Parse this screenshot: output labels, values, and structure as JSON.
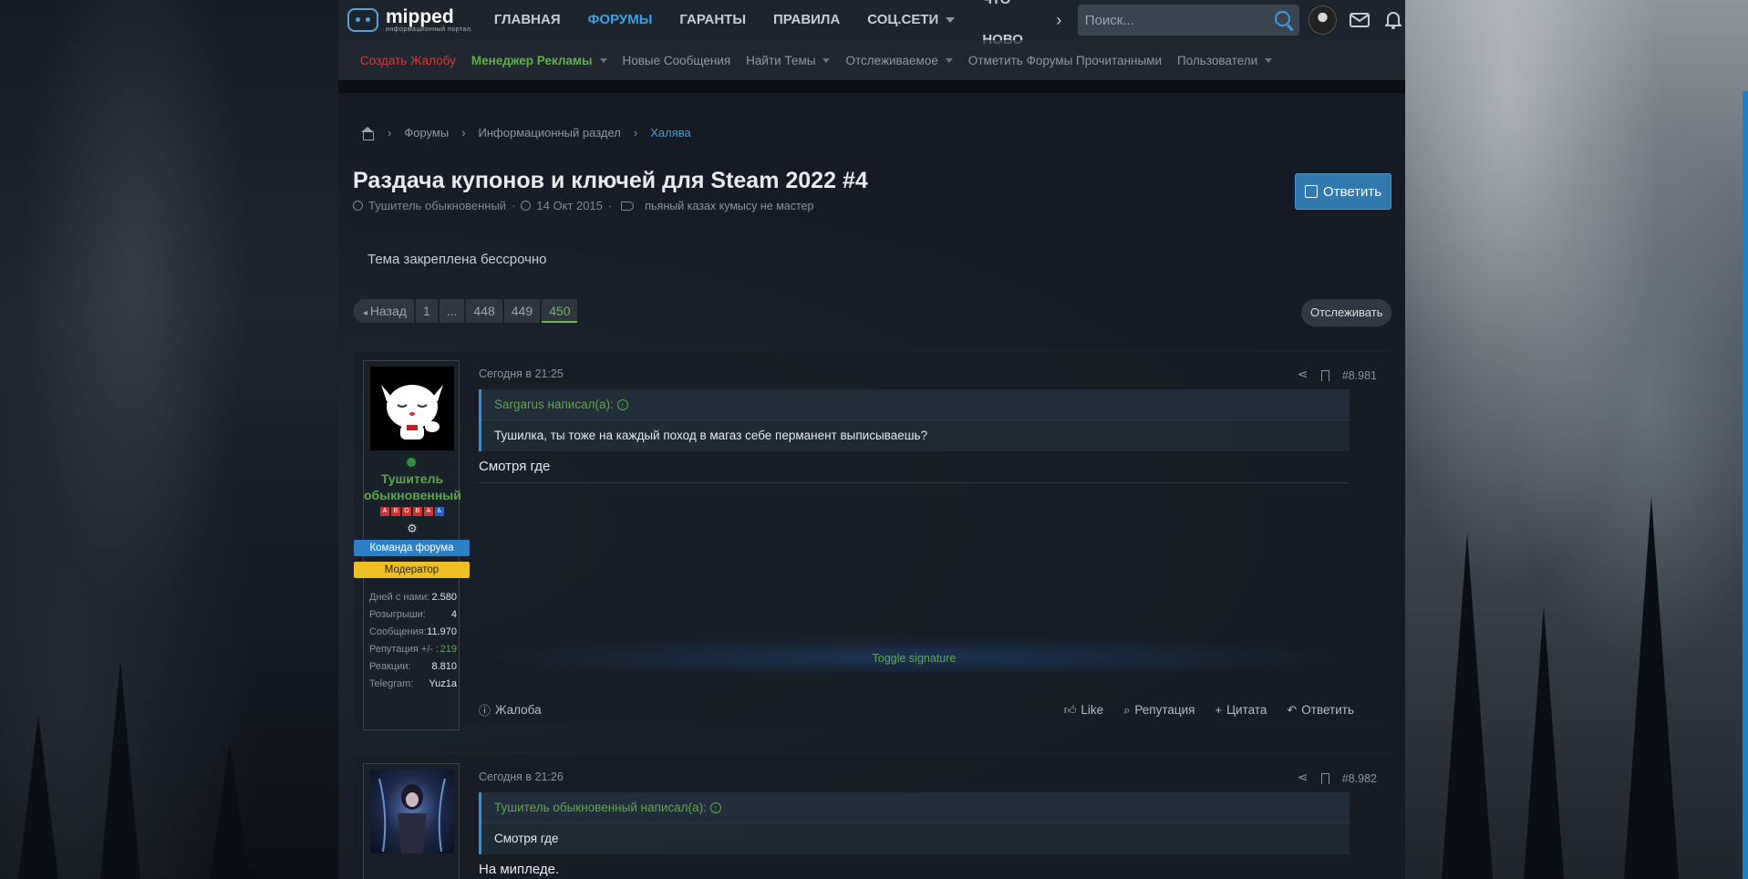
{
  "brand": {
    "name": "mipped",
    "subtitle": "информационный портал"
  },
  "nav": {
    "items": [
      {
        "label": "ГЛАВНАЯ",
        "active": false,
        "caret": false
      },
      {
        "label": "ФОРУМЫ",
        "active": true,
        "caret": false
      },
      {
        "label": "ГАРАНТЫ",
        "active": false,
        "caret": false
      },
      {
        "label": "ПРАВИЛА",
        "active": false,
        "caret": false
      },
      {
        "label": "СОЦ.СЕТИ",
        "active": false,
        "caret": true
      },
      {
        "label": "ЧТО НОВО",
        "active": false,
        "caret": false
      }
    ],
    "more_icon": "chevron-right-icon",
    "search_placeholder": "Поиск..."
  },
  "subnav": {
    "items": [
      {
        "label": "Создать Жалобу",
        "style": "red",
        "caret": false
      },
      {
        "label": "Менеджер Рекламы",
        "style": "green",
        "caret": true
      },
      {
        "label": "Новые Сообщения",
        "style": "",
        "caret": false
      },
      {
        "label": "Найти Темы",
        "style": "",
        "caret": true
      },
      {
        "label": "Отслеживаемое",
        "style": "",
        "caret": true
      },
      {
        "label": "Отметить Форумы Прочитанными",
        "style": "",
        "caret": false
      },
      {
        "label": "Пользователи",
        "style": "",
        "caret": true
      }
    ]
  },
  "breadcrumb": {
    "items": [
      "Форумы",
      "Информационный раздел"
    ],
    "current": "Халява"
  },
  "thread": {
    "title": "Раздача купонов и ключей для Steam 2022 #4",
    "author": "Тушитель обыкновенный",
    "date": "14 Окт 2015",
    "tags": "пьяный казах кумысу не мастер",
    "reply_label": "Ответить",
    "notice": "Тема закреплена бессрочно"
  },
  "pager": {
    "prev_label": "Назад",
    "pages": [
      "1",
      "...",
      "448",
      "449",
      "450"
    ],
    "current": "450",
    "watch_label": "Отслеживать"
  },
  "posts": [
    {
      "time": "Сегодня в 21:25",
      "number": "#8.981",
      "quote_author": "Sargarus написал(а):",
      "quote_text": "Тушилка, ты тоже на каждый поход в магаз себе перманент выписываешь?",
      "text": "Смотря где",
      "user": {
        "name": "Тушитель обыкновенный",
        "badges": [
          "А",
          "В",
          "О",
          "В",
          "А",
          "♿"
        ],
        "role_team": "Команда форума",
        "role_mod": "Модератор",
        "stats": [
          {
            "k": "Дней с нами:",
            "v": "2.580",
            "green": false
          },
          {
            "k": "Розыгрыши:",
            "v": "4",
            "green": false
          },
          {
            "k": "Сообщения:",
            "v": "11.970",
            "green": false
          },
          {
            "k": "Репутация +/- :",
            "v": "219",
            "green": true
          },
          {
            "k": "Реакции:",
            "v": "8.810",
            "green": false
          },
          {
            "k": "Telegram:",
            "v": "Yuz1a",
            "green": false
          }
        ]
      },
      "toggle_signature": "Toggle signature",
      "actions": {
        "report": "Жалоба",
        "like": "Like",
        "reputation": "Репутация",
        "quote": "Цитата",
        "reply": "Ответить"
      }
    },
    {
      "time": "Сегодня в 21:26",
      "number": "#8.982",
      "quote_author": "Тушитель обыкновенный написал(а):",
      "quote_text": "Смотря где",
      "text": "На мипледе."
    }
  ]
}
